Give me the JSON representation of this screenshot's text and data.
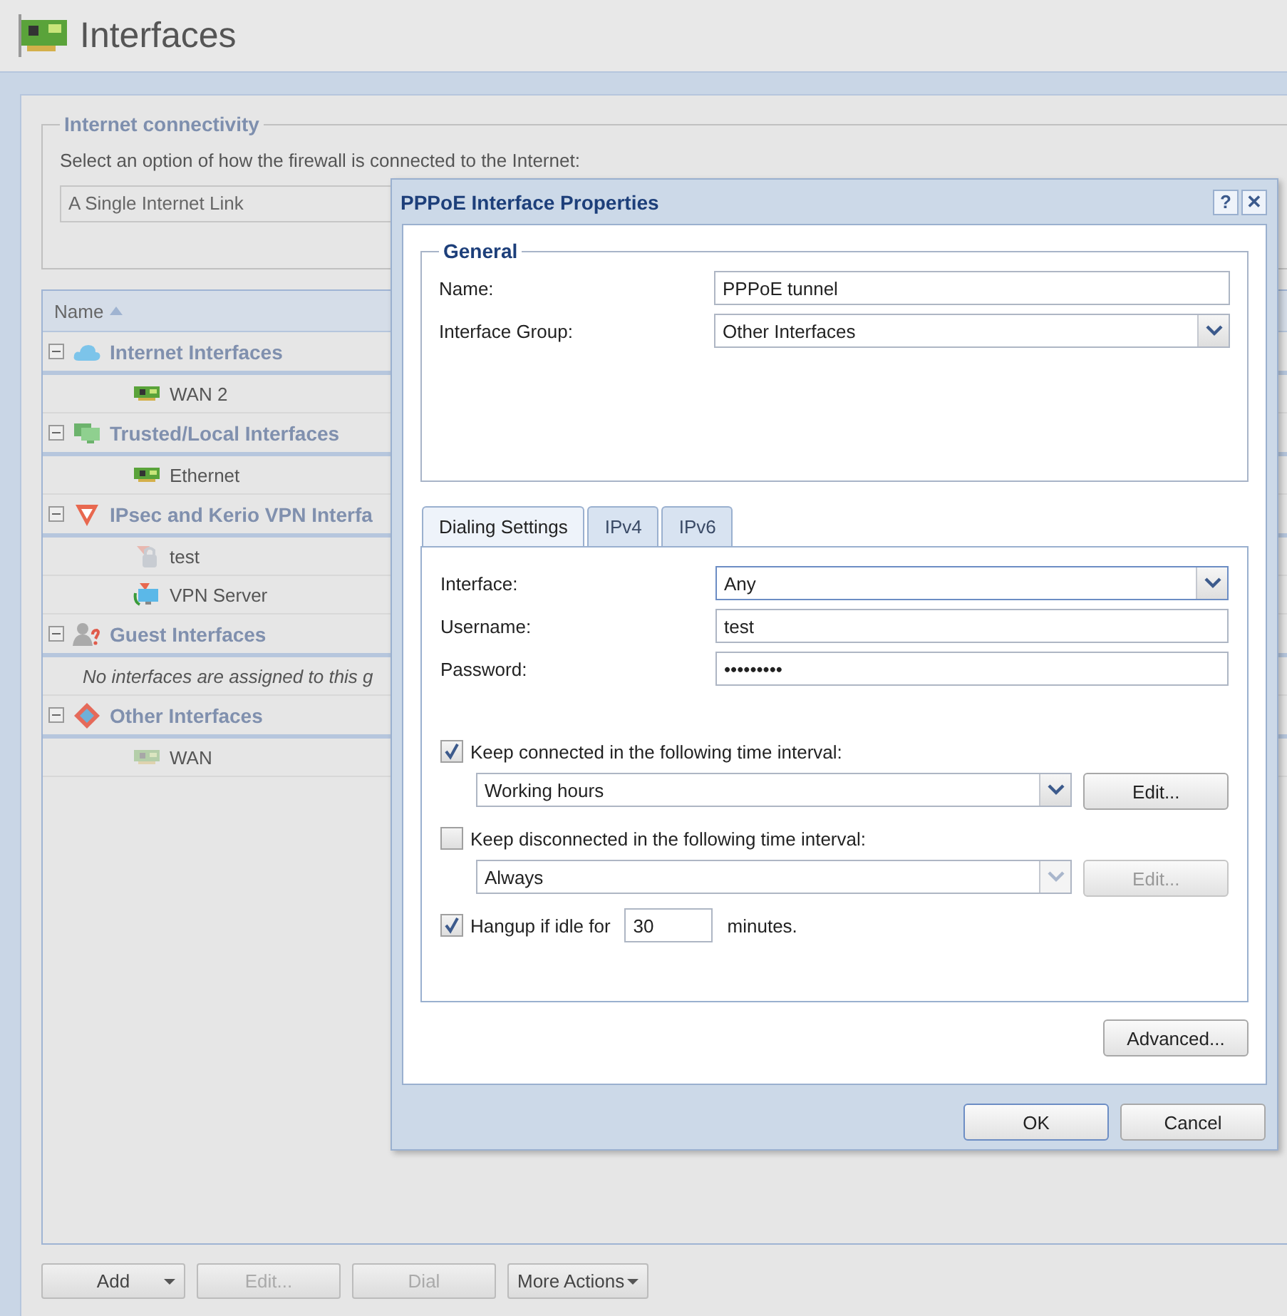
{
  "page": {
    "title": "Interfaces"
  },
  "connectivity": {
    "legend": "Internet connectivity",
    "prompt": "Select an option of how the firewall is connected to the Internet:",
    "mode": "A Single Internet Link"
  },
  "grid": {
    "columns": [
      {
        "label": "Name",
        "sorted": true
      }
    ],
    "groups": [
      {
        "label": "Internet Interfaces",
        "kind": "cloud",
        "expanded": true,
        "items": [
          {
            "name": "WAN 2",
            "kind": "nic"
          }
        ]
      },
      {
        "label": "Trusted/Local Interfaces",
        "kind": "monitor",
        "expanded": true,
        "items": [
          {
            "name": "Ethernet",
            "kind": "nic"
          }
        ]
      },
      {
        "label": "IPsec and Kerio VPN Interfa",
        "kind": "shield",
        "expanded": true,
        "items": [
          {
            "name": "test",
            "kind": "lock"
          },
          {
            "name": "VPN Server",
            "kind": "vpn"
          }
        ]
      },
      {
        "label": "Guest Interfaces",
        "kind": "guest",
        "expanded": true,
        "note": "No interfaces are assigned to this g"
      },
      {
        "label": "Other Interfaces",
        "kind": "diamond",
        "expanded": true,
        "items": [
          {
            "name": "WAN",
            "kind": "inactive"
          }
        ]
      }
    ]
  },
  "toolbar": [
    {
      "label": "Add",
      "disabled": false,
      "menu": true
    },
    {
      "label": "Edit...",
      "disabled": true,
      "menu": false
    },
    {
      "label": "Dial",
      "disabled": true,
      "menu": false
    },
    {
      "label": "More Actions",
      "disabled": false,
      "menu": true
    }
  ],
  "dialog": {
    "title": "PPPoE Interface Properties",
    "help": "?",
    "close": "✕",
    "general": {
      "legend": "General",
      "name_label": "Name:",
      "name": "PPPoE tunnel",
      "group_label": "Interface Group:",
      "group": "Other Interfaces"
    },
    "tabs": [
      {
        "label": "Dialing Settings",
        "selected": true
      },
      {
        "label": "IPv4",
        "selected": false
      },
      {
        "label": "IPv6",
        "selected": false
      }
    ],
    "interface_label": "Interface:",
    "interface": "Any",
    "username_label": "Username:",
    "username": "test",
    "password_label": "Password:",
    "password": "•••••••••",
    "keep_connected": {
      "label": "Keep connected in the following time interval:",
      "checked": true,
      "interval": "Working hours",
      "edit": "Edit..."
    },
    "keep_disconnected": {
      "label": "Keep disconnected in the following time interval:",
      "checked": false,
      "interval": "Always",
      "edit": "Edit..."
    },
    "hangup": {
      "label": "Hangup if idle for",
      "checked": true,
      "minutes": "30",
      "unit": "minutes."
    },
    "advanced": "Advanced...",
    "ok": "OK",
    "cancel": "Cancel"
  }
}
